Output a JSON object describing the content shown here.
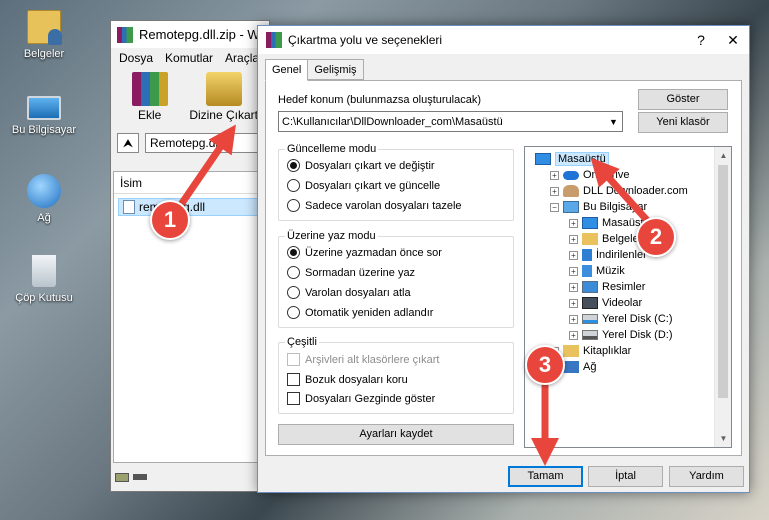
{
  "desktop": {
    "icons": [
      {
        "label": "Belgeler",
        "icon": "documents-folder-icon"
      },
      {
        "label": "Bu Bilgisayar",
        "icon": "computer-icon"
      },
      {
        "label": "Ağ",
        "icon": "network-icon"
      },
      {
        "label": "Çöp Kutusu",
        "icon": "recycle-bin-icon"
      }
    ]
  },
  "winrar": {
    "title": "Remotepg.dll.zip - W",
    "menu": [
      "Dosya",
      "Komutlar",
      "Araçla"
    ],
    "toolbar": {
      "add": "Ekle",
      "extract_to": "Dizine Çıkart"
    },
    "path": "Remotepg.dll",
    "column_name": "İsim",
    "file": "remotepg.dll"
  },
  "dialog": {
    "title": "Çıkartma yolu ve seçenekleri",
    "help_symbol": "?",
    "close_symbol": "✕",
    "tabs": [
      "Genel",
      "Gelişmiş"
    ],
    "dest_label": "Hedef konum (bulunmazsa oluşturulacak)",
    "dest_value": "C:\\Kullanıcılar\\DllDownloader_com\\Masaüstü",
    "show_button": "Göster",
    "new_folder_button": "Yeni klasör",
    "update_mode": {
      "title": "Güncelleme modu",
      "options": [
        "Dosyaları çıkart ve değiştir",
        "Dosyaları çıkart ve güncelle",
        "Sadece varolan dosyaları tazele"
      ],
      "selected": 0
    },
    "overwrite_mode": {
      "title": "Üzerine yaz modu",
      "options": [
        "Üzerine yazmadan önce sor",
        "Sormadan üzerine yaz",
        "Varolan dosyaları atla",
        "Otomatik yeniden adlandır"
      ],
      "selected": 0
    },
    "misc": {
      "title": "Çeşitli",
      "options": [
        "Arşivleri alt klasörlere çıkart",
        "Bozuk dosyaları koru",
        "Dosyaları Gezginde göster"
      ],
      "disabled": [
        true,
        false,
        false
      ],
      "checked": [
        false,
        false,
        false
      ]
    },
    "save_settings_button": "Ayarları kaydet",
    "tree": [
      {
        "label": "Masaüstü",
        "icon": "desktop-icon",
        "level": 0,
        "toggle": "",
        "selected": true
      },
      {
        "label": "OneDrive",
        "icon": "onedrive-icon",
        "level": 1,
        "toggle": "+"
      },
      {
        "label": "DLL Downloader.com",
        "icon": "user-icon",
        "level": 1,
        "toggle": "+"
      },
      {
        "label": "Bu Bilgisayar",
        "icon": "computer-icon",
        "level": 1,
        "toggle": "−"
      },
      {
        "label": "Masaüstü",
        "icon": "desktop-icon",
        "level": 2,
        "toggle": "+"
      },
      {
        "label": "Belgeler",
        "icon": "documents-icon",
        "level": 2,
        "toggle": "+"
      },
      {
        "label": "İndirilenler",
        "icon": "downloads-icon",
        "level": 2,
        "toggle": "+"
      },
      {
        "label": "Müzik",
        "icon": "music-icon",
        "level": 2,
        "toggle": "+"
      },
      {
        "label": "Resimler",
        "icon": "pictures-icon",
        "level": 2,
        "toggle": "+"
      },
      {
        "label": "Videolar",
        "icon": "videos-icon",
        "level": 2,
        "toggle": "+"
      },
      {
        "label": "Yerel Disk (C:)",
        "icon": "drive-c-icon",
        "level": 2,
        "toggle": "+"
      },
      {
        "label": "Yerel Disk (D:)",
        "icon": "drive-d-icon",
        "level": 2,
        "toggle": "+"
      },
      {
        "label": "Kitaplıklar",
        "icon": "libraries-icon",
        "level": 1,
        "toggle": "+"
      },
      {
        "label": "Ağ",
        "icon": "network-icon",
        "level": 1,
        "toggle": "+"
      }
    ],
    "buttons": {
      "ok": "Tamam",
      "cancel": "İptal",
      "help": "Yardım"
    }
  },
  "annotations": {
    "step1": "1",
    "step2": "2",
    "step3": "3",
    "color": "#e8463c"
  }
}
